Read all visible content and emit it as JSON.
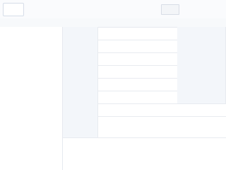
{
  "header": {
    "title": ""
  },
  "columns": {
    "left": "",
    "c1": "",
    "c2": "",
    "c3": "",
    "c4": ""
  },
  "left": {
    "company_name": "",
    "line_2": "",
    "line_3": "",
    "line_4": "",
    "line_5": ""
  },
  "info": {
    "r1_label": "",
    "r1_value": "",
    "r1_label2": "",
    "r2_label": "",
    "r2_value": "",
    "r2_label2": "",
    "r3_label": "",
    "r3_value": "",
    "r3_label2": "",
    "r4_label": "",
    "r4_value": "",
    "r4_label2": "",
    "r5_label": "",
    "r5_value": "",
    "r5_label2": "",
    "r6_label": "",
    "r6_value": "",
    "r6_label2": "",
    "r7_label": "",
    "r7_value": "",
    "r8_label": "",
    "r8_value_line_1": "",
    "r8_value_line_2": ""
  },
  "address": {
    "text": ""
  },
  "scope": {
    "line_1": "",
    "line_2": ""
  },
  "colors": {
    "link": "#2f6fd6",
    "label_bg": "#f3f6fa",
    "border": "#e8ebf0"
  }
}
